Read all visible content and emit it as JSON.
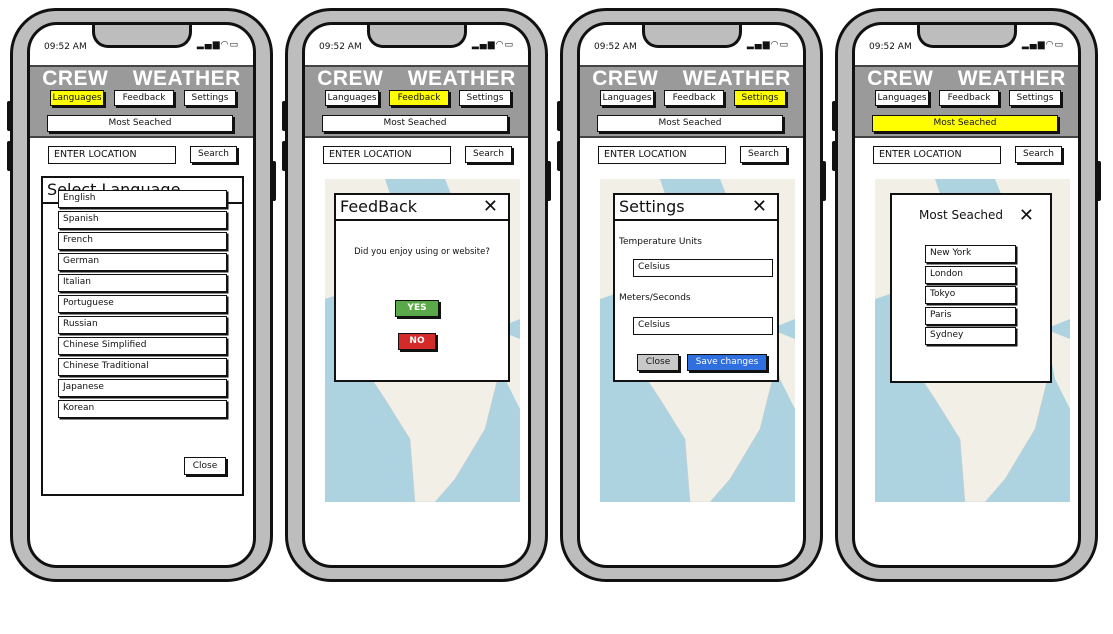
{
  "status": {
    "time": "09:52 AM",
    "icons": [
      "signal-icon",
      "wifi-icon",
      "battery-icon"
    ]
  },
  "header": {
    "brand": "CREW WEATHER",
    "tabs": [
      "Languages",
      "Feedback",
      "Settings"
    ],
    "most_searched": "Most Seached"
  },
  "search": {
    "placeholder": "ENTER LOCATION",
    "button": "Search"
  },
  "active_tab": [
    "Languages",
    "Feedback",
    "Settings",
    "Most Seached"
  ],
  "colors": {
    "header": "#9a9a9a",
    "active": "#ffff00",
    "yes": "#5aa84a",
    "no": "#d42a2a",
    "save": "#2f6fe0",
    "map_water": "#aed3e0",
    "map_land": "#f1efe6"
  },
  "language_modal": {
    "title": "Select Language",
    "items": [
      "English",
      "Spanish",
      "French",
      "German",
      "Italian",
      "Portuguese",
      "Russian",
      "Chinese Simplified",
      "Chinese Traditional",
      "Japanese",
      "Korean"
    ],
    "close": "Close"
  },
  "feedback_modal": {
    "title": "FeedBack",
    "question": "Did you enjoy using or website?",
    "yes": "YES",
    "no": "NO"
  },
  "settings_modal": {
    "title": "Settings",
    "temp_label": "Temperature Units",
    "temp_value": "Celsius",
    "speed_label": "Meters/Seconds",
    "speed_value": "Celsius",
    "close": "Close",
    "save": "Save changes"
  },
  "most_modal": {
    "title": "Most Seached",
    "items": [
      "New York",
      "London",
      "Tokyo",
      "Paris",
      "Sydney"
    ]
  }
}
